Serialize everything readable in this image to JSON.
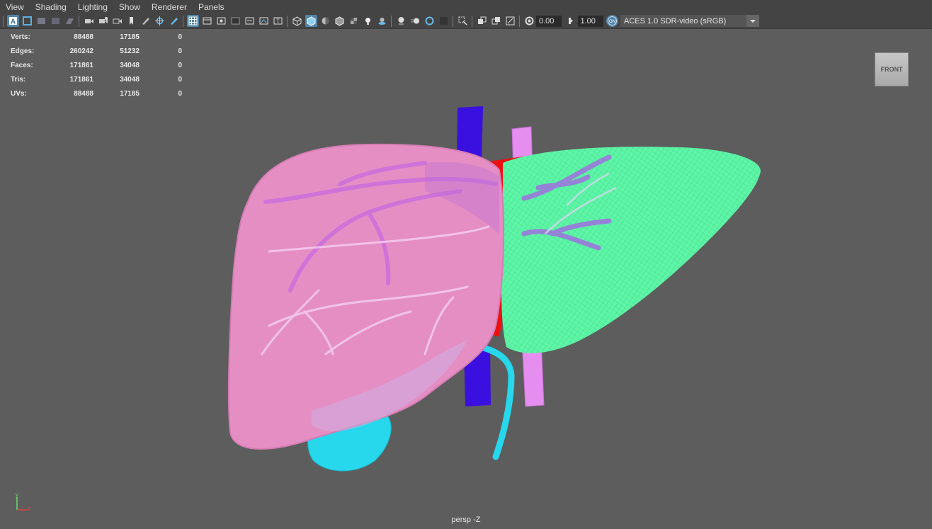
{
  "menu": [
    "View",
    "Shading",
    "Lighting",
    "Show",
    "Renderer",
    "Panels"
  ],
  "toolbar": {
    "exposure": "0.00",
    "gamma": "1.00",
    "color_space": "ACES 1.0 SDR-video (sRGB)"
  },
  "hud": {
    "rows": [
      {
        "label": "Verts:",
        "values": [
          "88488",
          "17185",
          "0"
        ]
      },
      {
        "label": "Edges:",
        "values": [
          "260242",
          "51232",
          "0"
        ]
      },
      {
        "label": "Faces:",
        "values": [
          "171861",
          "34048",
          "0"
        ]
      },
      {
        "label": "Tris:",
        "values": [
          "171861",
          "34048",
          "0"
        ]
      },
      {
        "label": "UVs:",
        "values": [
          "88488",
          "17185",
          "0"
        ]
      }
    ]
  },
  "viewcube": {
    "label": "FRONT"
  },
  "camera": {
    "label": "persp -Z"
  },
  "axis": {
    "y": "y",
    "x": "x"
  },
  "colors": {
    "viewport_bg": "#5d5d5d",
    "liver_right_lobe": "#e58ec4",
    "liver_left_lobe": "#5ff5a7",
    "inferior_vena_cava": "#3a10e0",
    "hepatic_vein": "#e58ef0",
    "portal_tissue": "#ee1010",
    "gallbladder": "#27d7ec",
    "accent": "#5285a6"
  }
}
